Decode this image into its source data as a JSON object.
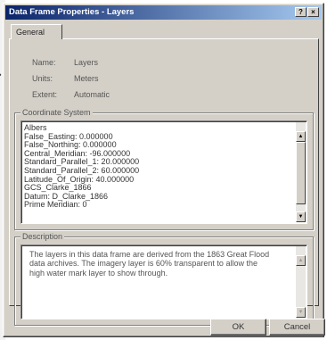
{
  "window": {
    "title": "Data Frame Properties - Layers",
    "help_glyph": "?",
    "close_glyph": "×"
  },
  "tabs": [
    {
      "label": "General"
    }
  ],
  "properties": {
    "name_label": "Name:",
    "name_value": "Layers",
    "units_label": "Units:",
    "units_value": "Meters",
    "extent_label": "Extent:",
    "extent_value": "Automatic"
  },
  "coordinate_system": {
    "legend": "Coordinate System",
    "lines": [
      "Albers",
      "False_Easting: 0.000000",
      "False_Northing: 0.000000",
      "Central_Meridian: -96.000000",
      "Standard_Parallel_1: 20.000000",
      "Standard_Parallel_2: 60.000000",
      "Latitude_Of_Origin: 40.000000",
      "GCS_Clarke_1866",
      "Datum: D_Clarke_1866",
      "Prime Meridian: 0"
    ]
  },
  "description": {
    "legend": "Description",
    "text": "The layers in this data frame are derived from the 1863 Great Flood data archives. The imagery layer is 60% transparent to allow the high water mark layer to show through."
  },
  "buttons": {
    "ok": "OK",
    "cancel": "Cancel"
  },
  "icons": {
    "scroll_up": "▲",
    "scroll_down": "▼"
  },
  "colors": {
    "title_bar_start": "#0a246a",
    "title_bar_end": "#a6caf0",
    "dialog_face": "#d4d0c8"
  }
}
